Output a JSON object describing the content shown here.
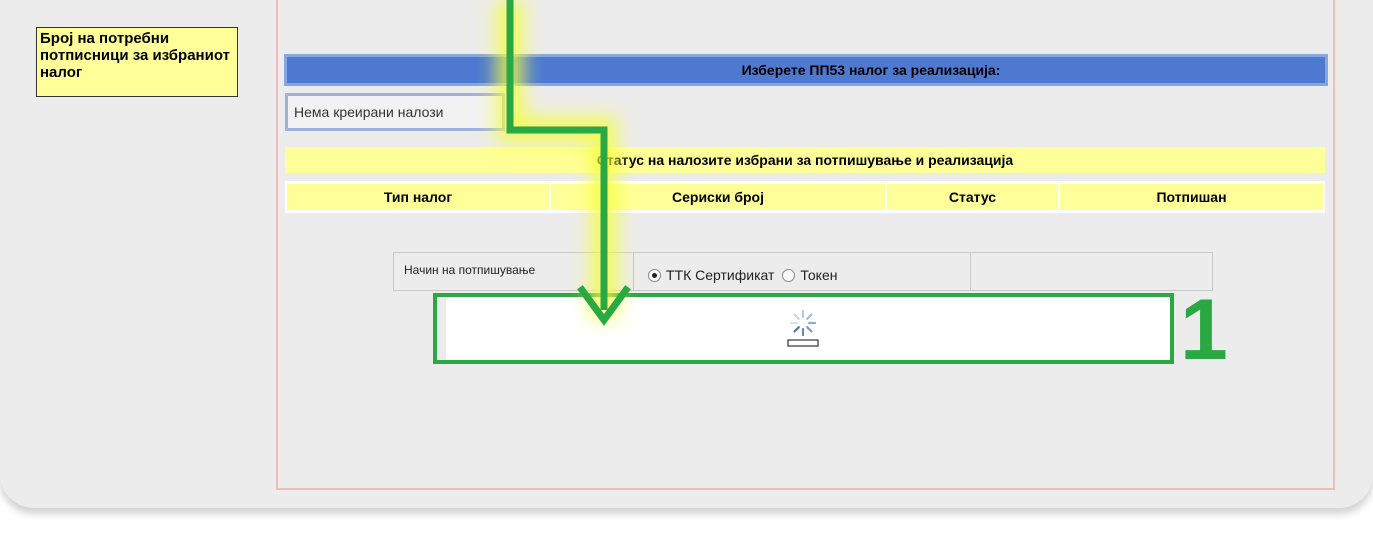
{
  "note": {
    "text": "Број на потребни потписници за избраниот налог"
  },
  "select_section": {
    "header": "Изберете ПП53 налог за реализација:",
    "orders_value": "Нема креирани налози"
  },
  "status_section": {
    "title": "Статус на налозите избрани за потпишување и реализација",
    "columns": [
      "Тип налог",
      "Сериски број",
      "Статус",
      "Потпишан"
    ]
  },
  "signing": {
    "label": "Начин на потпишување",
    "options": [
      {
        "label": "ТТК Сертификат",
        "selected": true
      },
      {
        "label": "Токен",
        "selected": false
      }
    ]
  },
  "annotation": {
    "number": "1",
    "color": "#2aa843"
  },
  "colors": {
    "header_blue": "#4d79d1",
    "highlight_yellow": "#ffff99",
    "frame_pink": "#efbcbc"
  }
}
